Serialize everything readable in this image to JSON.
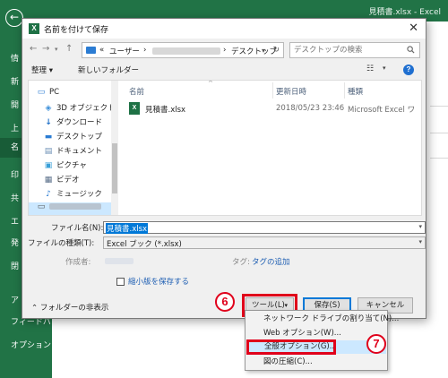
{
  "excel": {
    "window_title": "見積書.xlsx  -  Excel",
    "sidebar_items": [
      "情",
      "新",
      "開",
      "上",
      "名",
      "印",
      "共",
      "エ",
      "発",
      "閉",
      "ア",
      "フィードバック",
      "オプション"
    ]
  },
  "dialog": {
    "title": "名前を付けて保存",
    "address": {
      "prefix": "«",
      "user": "ユーザー",
      "sep1": "›",
      "sep2": "›",
      "folder": "デスクトップ"
    },
    "search_placeholder": "デスクトップの検索",
    "toolbar": {
      "organize": "整理 ▾",
      "new_folder": "新しいフォルダー"
    },
    "nav_items": [
      {
        "label": "PC",
        "icon": "pc-icon",
        "glyph": "▭"
      },
      {
        "label": "3D オブジェクト",
        "icon": "3d-objects-icon",
        "glyph": "◈"
      },
      {
        "label": "ダウンロード",
        "icon": "download-icon",
        "glyph": "↓"
      },
      {
        "label": "デスクトップ",
        "icon": "desktop-icon",
        "glyph": "▬"
      },
      {
        "label": "ドキュメント",
        "icon": "documents-icon",
        "glyph": "▤"
      },
      {
        "label": "ピクチャ",
        "icon": "pictures-icon",
        "glyph": "▣"
      },
      {
        "label": "ビデオ",
        "icon": "videos-icon",
        "glyph": "▦"
      },
      {
        "label": "ミュージック",
        "icon": "music-icon",
        "glyph": "♪"
      }
    ],
    "columns": {
      "name": "名前",
      "modified": "更新日時",
      "type": "種類"
    },
    "files": [
      {
        "name": "見積書.xlsx",
        "modified": "2018/05/23 23:46",
        "type": "Microsoft Excel ワ"
      }
    ],
    "filename_label": "ファイル名(N):",
    "filename_value": "見積書.xlsx",
    "filetype_label": "ファイルの種類(T):",
    "filetype_value": "Excel ブック (*.xlsx)",
    "author_label": "作成者:",
    "tags_label": "タグ:",
    "tags_link": "タグの追加",
    "thumbnail_label": "縮小版を保存する",
    "hide_folders": "フォルダーの非表示",
    "tools_button": "ツール(L)",
    "save_button": "保存(S)",
    "cancel_button": "キャンセル"
  },
  "tools_menu": [
    "ネットワーク ドライブの割り当て(N)...",
    "Web オプション(W)...",
    "全般オプション(G)...",
    "図の圧縮(C)..."
  ],
  "steps": {
    "step6": "6",
    "step7": "7"
  },
  "colors": {
    "excel_green": "#217346",
    "highlight_red": "#e0001b",
    "selection_blue": "#0078d7"
  }
}
